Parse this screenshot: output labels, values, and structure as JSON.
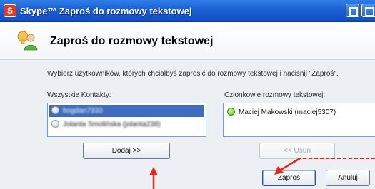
{
  "window": {
    "app_logo": "S",
    "title": "Skype™  Zaproś do rozmowy tekstowej",
    "min_icon": "restore-icon",
    "max_icon": "maximize-icon"
  },
  "header": {
    "title": "Zaproś do rozmowy tekstowej",
    "icon": "invite-contact-icon"
  },
  "instructions": "Wybierz użytkowników, których chciałbyś zaprosić do rozmowy tekstowej i naciśnij \"Zaproś\".",
  "contacts": {
    "label": "Wszystkie Kontakty:",
    "items": [
      {
        "label": "bogdan7333",
        "status": "offline",
        "selected": true
      },
      {
        "label": "Jolanta Smolińska (jolanta238)",
        "status": "offline",
        "selected": false
      }
    ]
  },
  "members": {
    "label": "Członkowie rozmowy tekstowej:",
    "items": [
      {
        "label": "Maciej Makowski (maciej5307)",
        "status": "online"
      }
    ]
  },
  "buttons": {
    "add": "Dodaj >>",
    "remove": "<< Usuń",
    "invite": "Zaproś",
    "cancel": "Anuluj"
  },
  "colors": {
    "titlebar": "#1a5fd3",
    "selection": "#3d6cc0",
    "annotation_arrow": "#e8261b",
    "online": "#5fb81f"
  }
}
